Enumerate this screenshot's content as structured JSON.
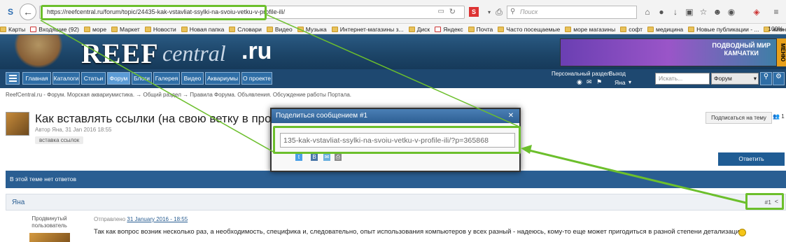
{
  "browser": {
    "url": "https://reefcentral.ru/forum/topic/24435-kak-vstavliat-ssylki-na-svoiu-vetku-v-profile-ili/",
    "search_placeholder": "Поиск",
    "back_icon": "back-arrow-icon"
  },
  "bookmarks": {
    "items": [
      "Карты",
      "Входящие (92)",
      "море",
      "Маркет",
      "Новости",
      "Новая папка",
      "Словари",
      "Видео",
      "Музыка",
      "Интернет-магазины з...",
      "Диск",
      "Яндекс",
      "Почта",
      "Часто посещаемые",
      "море магазины",
      "софт",
      "медицина",
      "Новые публикации - ...",
      "живность"
    ],
    "zoom": "100%"
  },
  "site": {
    "logo_main": "REEF",
    "logo_central": "central",
    "logo_tld": ".ru",
    "ad_text": "ПОДВОДНЫЙ МИР\nКАМЧАТКИ",
    "ad_side": "МЕНЮ"
  },
  "menu": {
    "items": [
      "Главная",
      "Каталоги",
      "Статьи",
      "Форум",
      "Блоги",
      "Галерея",
      "Видео",
      "Аквариумы",
      "О проекте"
    ],
    "active": "Форум",
    "personal": "Персональный раздел",
    "logout": "Выход",
    "username": "Яна",
    "search_placeholder": "Искать...",
    "scope": "Форум"
  },
  "breadcrumb": "ReefCentral.ru - Форум. Морская аквариумистика.  →  Общий раздел  →  Правила Форума. Объявления. Обсуждение работы Портала.",
  "topic": {
    "title": "Как вставлять ссылки (на свою ветку в про",
    "meta": "Автор Яна, 31 Jan 2016 18:55",
    "tag": "вставка ссылок",
    "subscribe": "Подписаться на тему",
    "followers": "1",
    "reply": "Ответить",
    "no_replies": "В этой теме нет ответов"
  },
  "post": {
    "author": "Яна",
    "number": "#1",
    "rank": "Продвинутый пользователь",
    "date_prefix": "Отправлено",
    "date": "31 January 2016 - 18:55",
    "body": "Так как вопрос возник несколько раз, а необходимость, специфика и, следовательно, опыт использования компьютеров у всех разный - надеюсь, кому-то еще может пригодиться в разной степени детализации"
  },
  "modal": {
    "title": "Поделиться сообщением #1",
    "share_url": "135-kak-vstavliat-ssylki-na-svoiu-vetku-v-profile-ili/?p=365868"
  },
  "colors": {
    "highlight": "#6cbf2c",
    "brand": "#1e4870"
  }
}
